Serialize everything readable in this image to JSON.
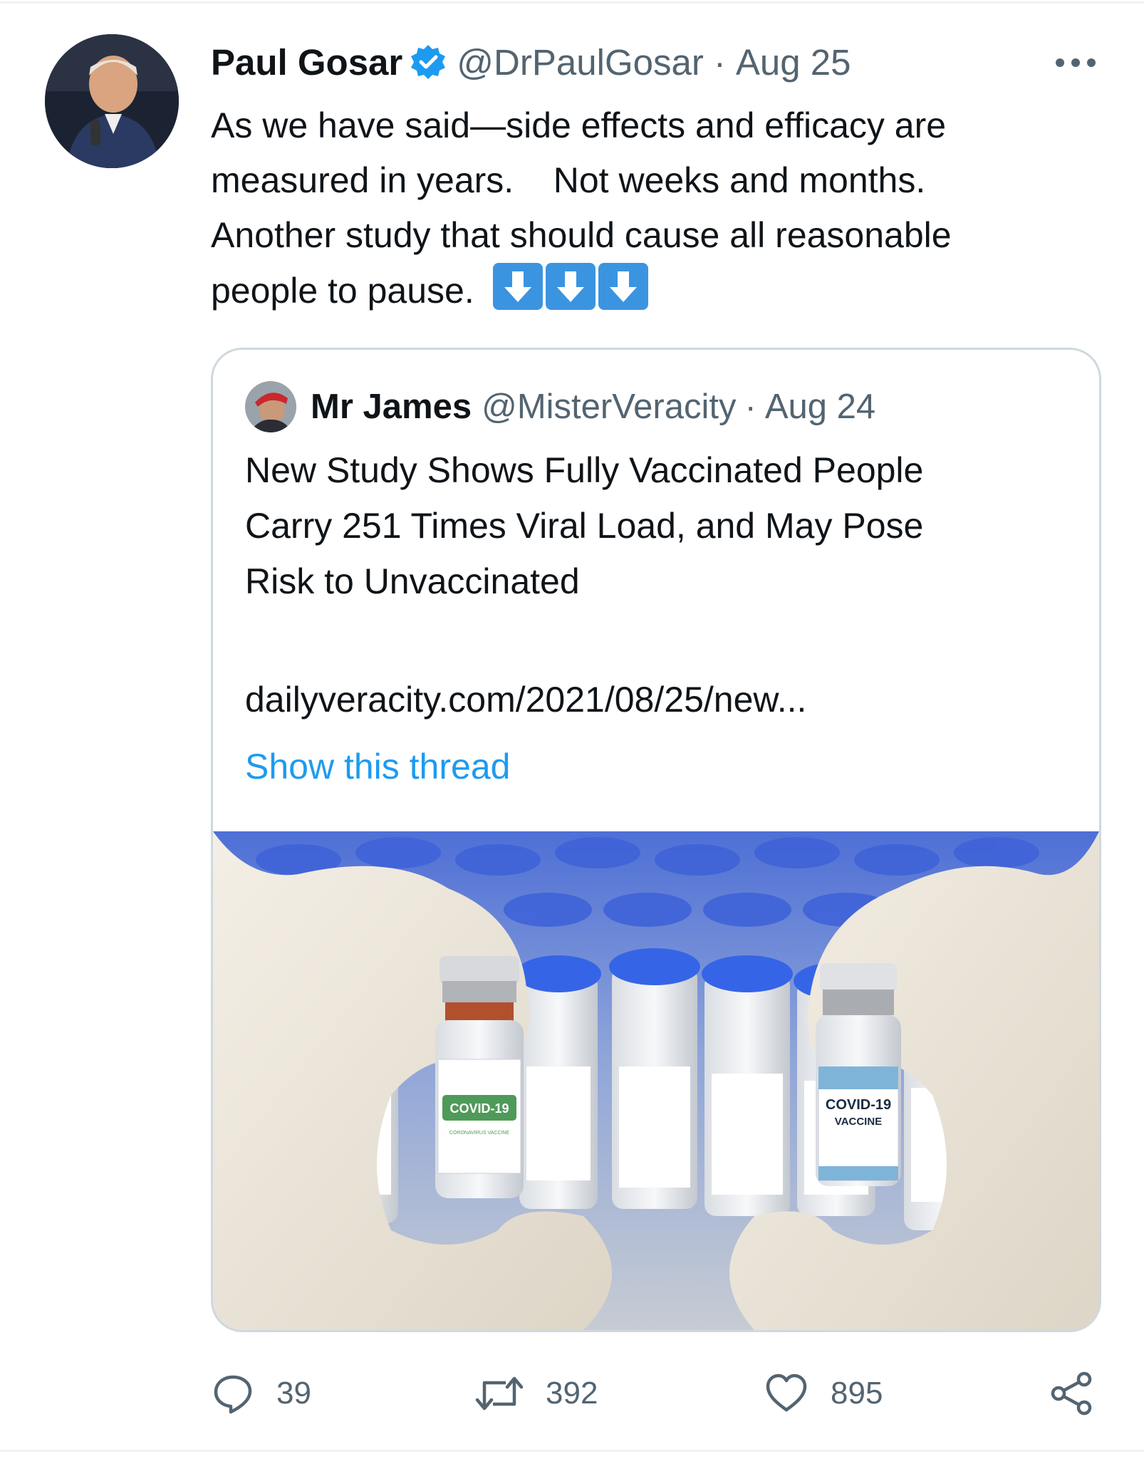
{
  "tweet": {
    "author_name": "Paul Gosar",
    "author_handle": "@DrPaulGosar",
    "separator": "·",
    "date": "Aug 25",
    "text": "As we have said—side effects and efficacy are\nmeasured in years.    Not weeks and months.\nAnother study that should cause all reasonable\npeople to pause.",
    "emoji": [
      "down-arrow-emoji",
      "down-arrow-emoji",
      "down-arrow-emoji"
    ]
  },
  "quoted_tweet": {
    "author_name": "Mr James",
    "author_handle": "@MisterVeracity",
    "separator": "·",
    "date": "Aug 24",
    "text": "New Study Shows Fully Vaccinated People\nCarry 251 Times Viral Load, and May Pose\nRisk to Unvaccinated",
    "link": "dailyveracity.com/2021/08/25/new...",
    "show_thread": "Show this thread",
    "media": {
      "left_vial_label": "COVID-19",
      "left_vial_sublabel": "CORONAVIRUS VACCINE",
      "right_vial_label": "COVID-19",
      "right_vial_sublabel": "VACCINE"
    }
  },
  "actions": {
    "replies": "39",
    "retweets": "392",
    "likes": "895"
  },
  "colors": {
    "link": "#1d9bf0",
    "secondary_text": "#536471",
    "border": "#cfd9de",
    "verified": "#1d9bf0",
    "emoji_blue": "#3b94e0"
  }
}
